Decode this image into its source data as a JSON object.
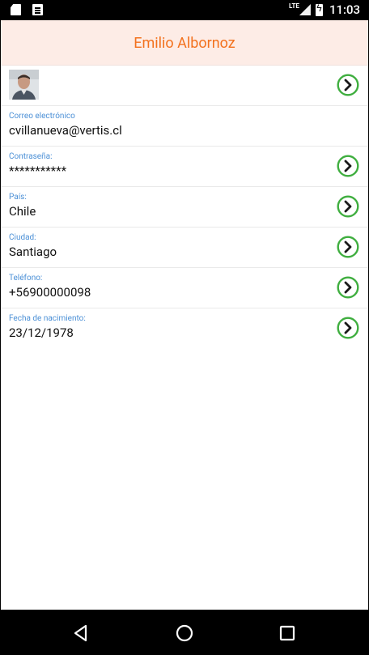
{
  "status_bar": {
    "network": "LTE",
    "time": "11:03"
  },
  "header": {
    "title": "Emilio Albornoz"
  },
  "profile": {
    "rows": [
      {
        "label": "Correo electrónico",
        "value": "cvillanueva@vertis.cl",
        "has_arrow": false
      },
      {
        "label": "Contraseña:",
        "value": "***********",
        "has_arrow": true
      },
      {
        "label": "País:",
        "value": "Chile",
        "has_arrow": true
      },
      {
        "label": "Ciudad:",
        "value": "Santiago",
        "has_arrow": true
      },
      {
        "label": "Teléfono:",
        "value": "+56900000098",
        "has_arrow": true
      },
      {
        "label": "Fecha de nacimiento:",
        "value": "23/12/1978",
        "has_arrow": true
      }
    ]
  },
  "colors": {
    "accent": "#f3711d",
    "header_bg": "#fdece6",
    "label": "#4a8fd6",
    "arrow": "#3fae3f"
  },
  "icons": {
    "row_arrow": "chevron-right-circle-icon",
    "nav_back": "back-icon",
    "nav_home": "home-icon",
    "nav_recents": "recents-icon"
  }
}
